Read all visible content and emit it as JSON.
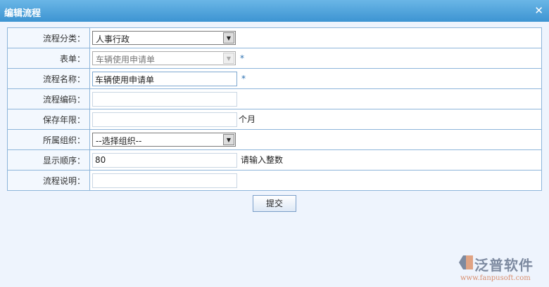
{
  "title": "编辑流程",
  "rows": [
    {
      "label": "流程分类：",
      "value": "人事行政"
    },
    {
      "label": "表单：",
      "value": "车辆使用申请单",
      "required": "*"
    },
    {
      "label": "流程名称：",
      "value": "车辆使用申请单",
      "required": "*"
    },
    {
      "label": "流程编码：",
      "value": ""
    },
    {
      "label": "保存年限：",
      "value": "",
      "suffix": "个月"
    },
    {
      "label": "所属组织：",
      "value": "--选择组织--"
    },
    {
      "label": "显示顺序：",
      "value": "80",
      "suffix": "请输入整数"
    },
    {
      "label": "流程说明：",
      "value": ""
    }
  ],
  "submit": "提交",
  "logo": {
    "name": "泛普软件",
    "url": "www.fanpusoft.com"
  }
}
